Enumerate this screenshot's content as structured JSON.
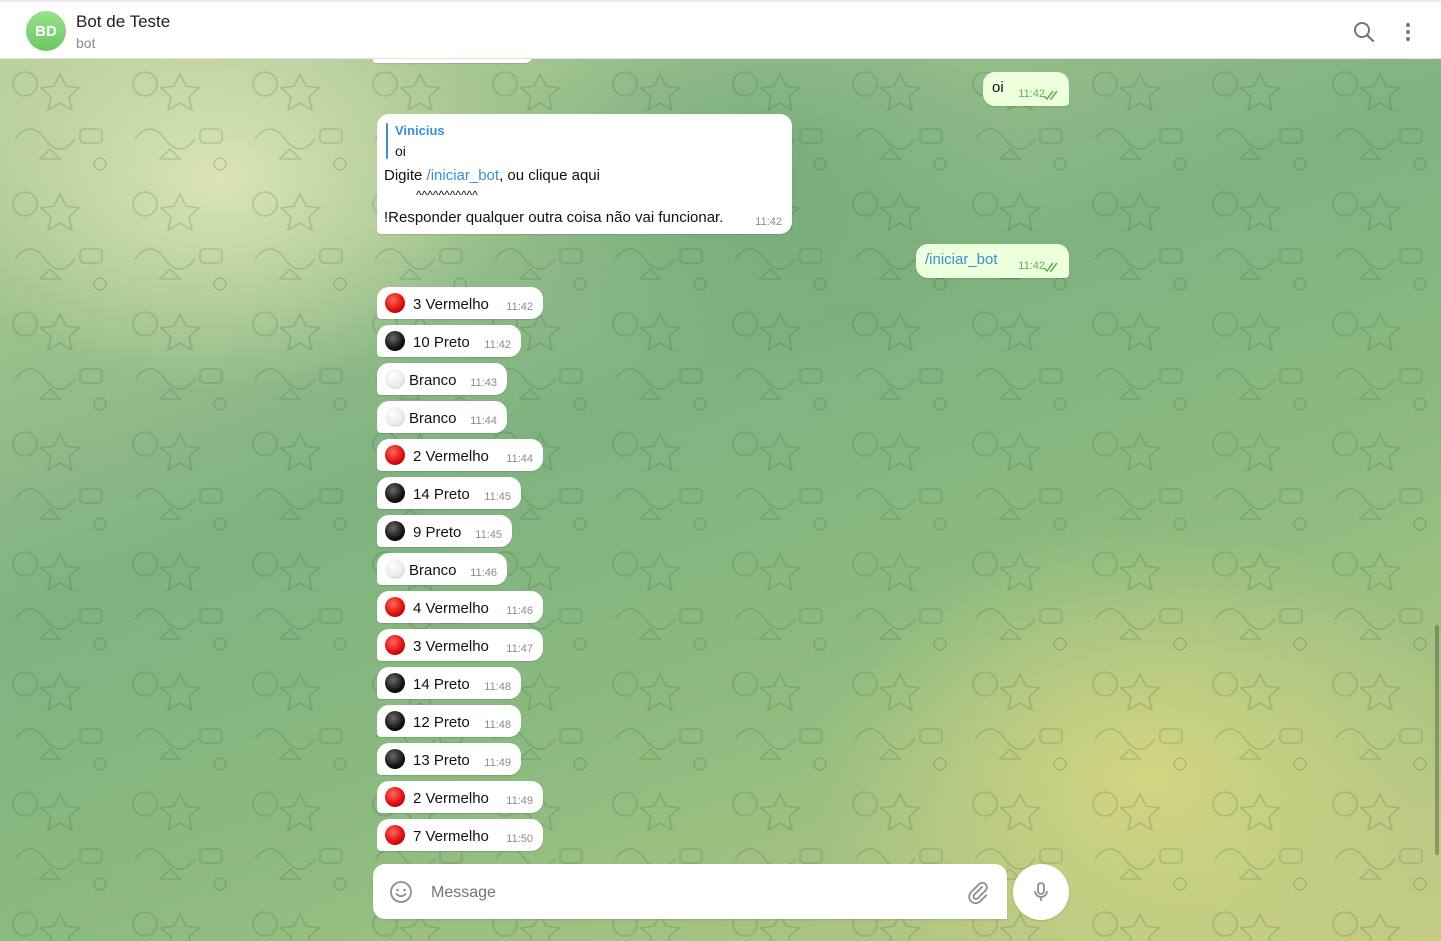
{
  "header": {
    "avatar_initials": "BD",
    "title": "Bot de Teste",
    "subtitle": "bot",
    "search_icon": "search-icon",
    "menu_icon": "more-vertical-icon"
  },
  "colors": {
    "outgoing_bubble": "#eeffde",
    "incoming_bubble": "#ffffff",
    "link": "#3a8fd0",
    "avatar": "#7fd072"
  },
  "messages": {
    "out1": {
      "text": "oi",
      "time": "11:42",
      "status": "read"
    },
    "bot_reply": {
      "reply_author": "Vinicius",
      "reply_text": "oi",
      "line1_prefix": "Digite ",
      "line1_link": "/iniciar_bot",
      "line1_suffix": ", ou clique aqui",
      "line2": "^^^^^^^^^^^",
      "line3": "!Responder qualquer outra coisa não vai funcionar.",
      "time": "11:42"
    },
    "out2": {
      "text": "/iniciar_bot",
      "time": "11:42",
      "status": "read"
    },
    "results": [
      {
        "color": "red",
        "text": "3 Vermelho",
        "time": "11:42"
      },
      {
        "color": "black",
        "text": "10 Preto",
        "time": "11:42"
      },
      {
        "color": "white",
        "text": "Branco",
        "time": "11:43"
      },
      {
        "color": "white",
        "text": "Branco",
        "time": "11:44"
      },
      {
        "color": "red",
        "text": "2 Vermelho",
        "time": "11:44"
      },
      {
        "color": "black",
        "text": "14 Preto",
        "time": "11:45"
      },
      {
        "color": "black",
        "text": "9 Preto",
        "time": "11:45"
      },
      {
        "color": "white",
        "text": "Branco",
        "time": "11:46"
      },
      {
        "color": "red",
        "text": "4 Vermelho",
        "time": "11:46"
      },
      {
        "color": "red",
        "text": "3 Vermelho",
        "time": "11:47"
      },
      {
        "color": "black",
        "text": "14 Preto",
        "time": "11:48"
      },
      {
        "color": "black",
        "text": "12 Preto",
        "time": "11:48"
      },
      {
        "color": "black",
        "text": "13 Preto",
        "time": "11:49"
      },
      {
        "color": "red",
        "text": "2 Vermelho",
        "time": "11:49"
      },
      {
        "color": "red",
        "text": "7 Vermelho",
        "time": "11:50"
      }
    ]
  },
  "composer": {
    "placeholder": "Message",
    "emoji_icon": "smile-icon",
    "attach_icon": "paperclip-icon",
    "mic_icon": "microphone-icon"
  }
}
